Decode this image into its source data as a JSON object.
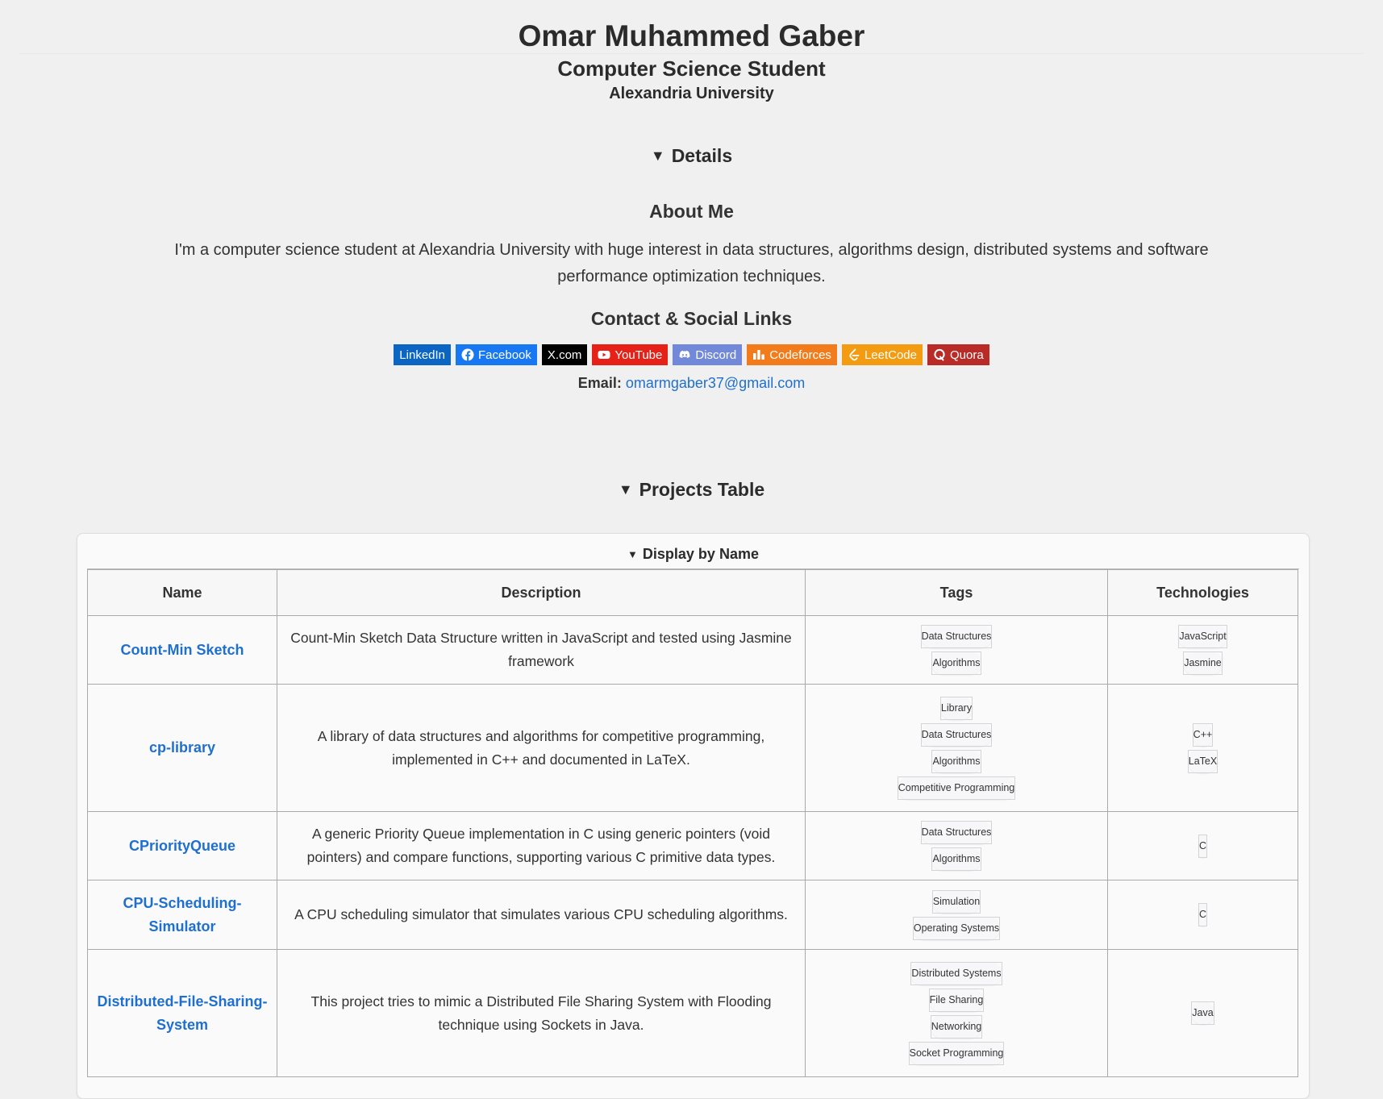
{
  "profile": {
    "name": "Omar Muhammed Gaber",
    "title": "Computer Science Student",
    "university": "Alexandria University"
  },
  "details": {
    "summary": "Details",
    "about_heading": "About Me",
    "about_text": "I'm a computer science student at Alexandria University with huge interest in data structures, algorithms design, distributed systems and software performance optimization techniques.",
    "contact_heading": "Contact & Social Links",
    "social": [
      {
        "label": "LinkedIn",
        "color": "#0a66c2",
        "icon": "none"
      },
      {
        "label": "Facebook",
        "color": "#1877f2",
        "icon": "facebook-icon"
      },
      {
        "label": "X.com",
        "color": "#000000",
        "icon": "none"
      },
      {
        "label": "YouTube",
        "color": "#e62117",
        "icon": "youtube-icon"
      },
      {
        "label": "Discord",
        "color": "#7289da",
        "icon": "discord-icon"
      },
      {
        "label": "Codeforces",
        "color": "#f27b1b",
        "icon": "codeforces-icon"
      },
      {
        "label": "LeetCode",
        "color": "#f39c12",
        "icon": "leetcode-icon"
      },
      {
        "label": "Quora",
        "color": "#b92b27",
        "icon": "quora-icon"
      }
    ],
    "email_label": "Email:",
    "email": "omarmgaber37@gmail.com"
  },
  "projects": {
    "summary": "Projects Table",
    "display_summary": "Display by Name",
    "headers": {
      "name": "Name",
      "description": "Description",
      "tags": "Tags",
      "technologies": "Technologies"
    },
    "rows": [
      {
        "name": "Count-Min Sketch",
        "description": "Count-Min Sketch Data Structure written in JavaScript and tested using Jasmine framework",
        "tags": [
          "Data Structures",
          "Algorithms"
        ],
        "technologies": [
          "JavaScript",
          "Jasmine"
        ]
      },
      {
        "name": "cp-library",
        "description": "A library of data structures and algorithms for competitive programming, implemented in C++ and documented in LaTeX.",
        "tags": [
          "Library",
          "Data Structures",
          "Algorithms",
          "Competitive Programming"
        ],
        "technologies": [
          "C++",
          "LaTeX"
        ]
      },
      {
        "name": "CPriorityQueue",
        "description": "A generic Priority Queue implementation in C using generic pointers (void pointers) and compare functions, supporting various C primitive data types.",
        "tags": [
          "Data Structures",
          "Algorithms"
        ],
        "technologies": [
          "C"
        ]
      },
      {
        "name": "CPU-Scheduling-Simulator",
        "description": "A CPU scheduling simulator that simulates various CPU scheduling algorithms.",
        "tags": [
          "Simulation",
          "Operating Systems"
        ],
        "technologies": [
          "C"
        ]
      },
      {
        "name": "Distributed-File-Sharing-System",
        "description": "This project tries to mimic a Distributed File Sharing System with Flooding technique using Sockets in Java.",
        "tags": [
          "Distributed Systems",
          "File Sharing",
          "Networking",
          "Socket Programming"
        ],
        "technologies": [
          "Java"
        ]
      }
    ]
  }
}
